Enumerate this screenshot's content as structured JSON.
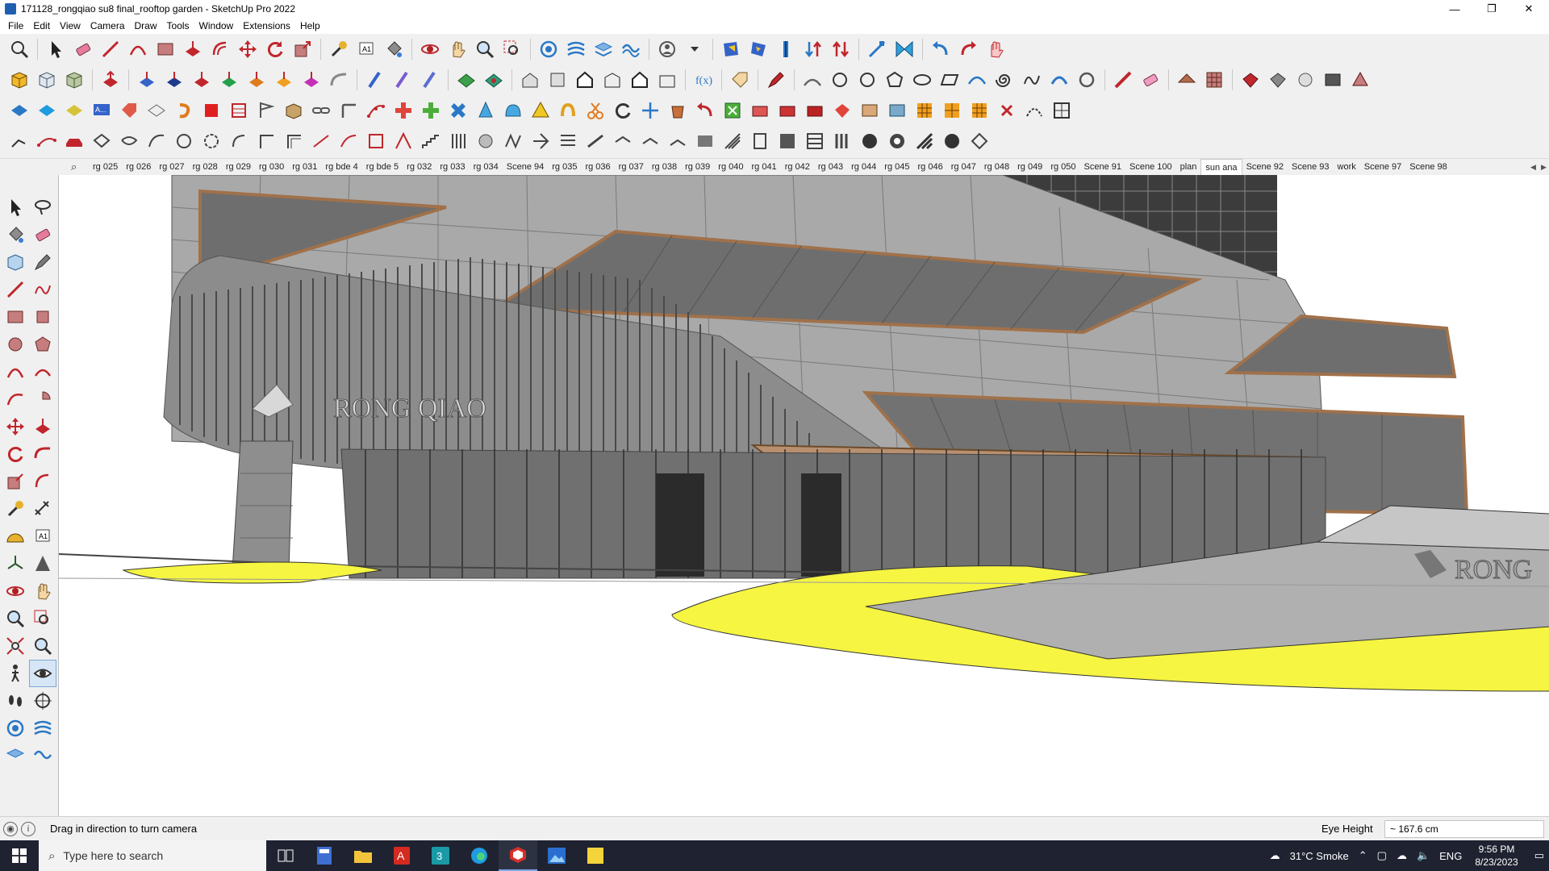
{
  "window": {
    "title": "171128_rongqiao su8 final_rooftop garden - SketchUp Pro 2022",
    "controls": {
      "minimize": "—",
      "restore": "❐",
      "close": "✕"
    }
  },
  "menu": [
    "File",
    "Edit",
    "View",
    "Camera",
    "Draw",
    "Tools",
    "Window",
    "Extensions",
    "Help"
  ],
  "scenes": {
    "tabs": [
      "rg 025",
      "rg 026",
      "rg 027",
      "rg 028",
      "rg 029",
      "rg 030",
      "rg 031",
      "rg bde 4",
      "rg bde 5",
      "rg 032",
      "rg 033",
      "rg 034",
      "Scene 94",
      "rg 035",
      "rg 036",
      "rg 037",
      "rg 038",
      "rg 039",
      "rg 040",
      "rg 041",
      "rg 042",
      "rg 043",
      "rg 044",
      "rg 045",
      "rg 046",
      "rg 047",
      "rg 048",
      "rg 049",
      "rg 050",
      "Scene 91",
      "Scene 100",
      "plan",
      "sun ana",
      "Scene 92",
      "Scene 93",
      "work",
      "Scene 97",
      "Scene 98"
    ],
    "active": "sun ana",
    "scroll_left": "◀",
    "scroll_right": "▶"
  },
  "viewport": {
    "sign_text": "RONG QIAO",
    "sign_text_2": "RONG"
  },
  "status": {
    "hint": "Drag in direction to turn camera",
    "measure_label": "Eye Height",
    "measure_value": "~ 167.6 cm"
  },
  "taskbar": {
    "search_placeholder": "Type here to search",
    "weather": "31°C  Smoke",
    "language": "ENG",
    "time": "9:56 PM",
    "date": "8/23/2023"
  },
  "colors": {
    "facade": "#a9a9a9",
    "glass": "#6e6e6e",
    "wood_trim": "#a0714a",
    "paving_highlight": "#f5f542",
    "taskbar": "#1f2230"
  }
}
